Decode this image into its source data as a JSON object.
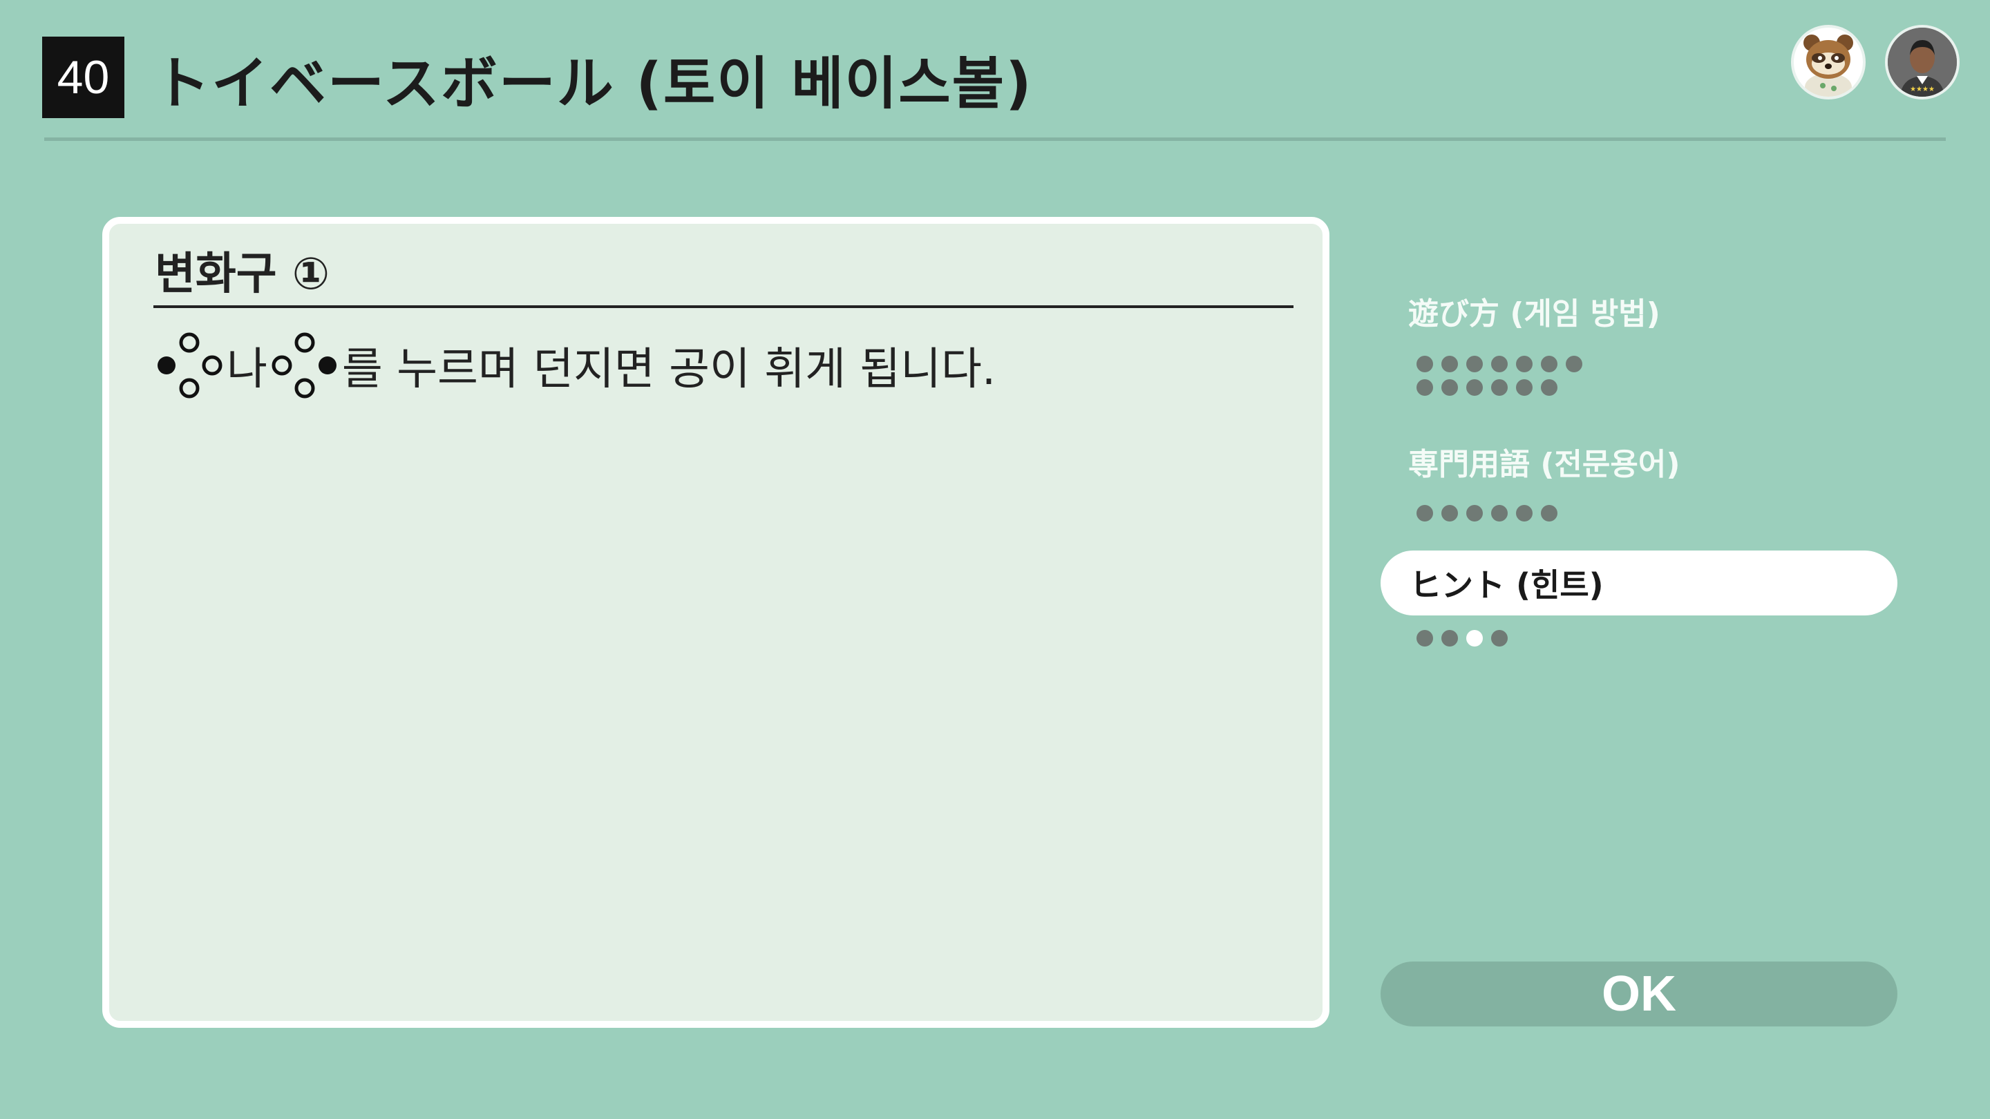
{
  "header": {
    "game_number": "40",
    "title": "トイベースボール (토이 베이스볼)"
  },
  "players": [
    {
      "icon": "raccoon-character-avatar"
    },
    {
      "icon": "person-avatar-with-stars"
    }
  ],
  "panel": {
    "title": "변화구 ①",
    "body_connector": "나",
    "body_text": "를 누르며 던지면 공이 휘게 됩니다."
  },
  "menu": {
    "items": [
      {
        "label": "遊び方 (게임 방법)",
        "pages": 13,
        "current": null
      },
      {
        "label": "専門用語 (전문용어)",
        "pages": 6,
        "current": null
      },
      {
        "label": "ヒント (힌트)",
        "pages": 4,
        "current": 3,
        "selected": true
      }
    ],
    "ok_label": "OK"
  },
  "colors": {
    "background": "#9bcfbc",
    "panel": "#e3efe5",
    "dot": "#707a75",
    "ok_button": "#83b2a1"
  }
}
